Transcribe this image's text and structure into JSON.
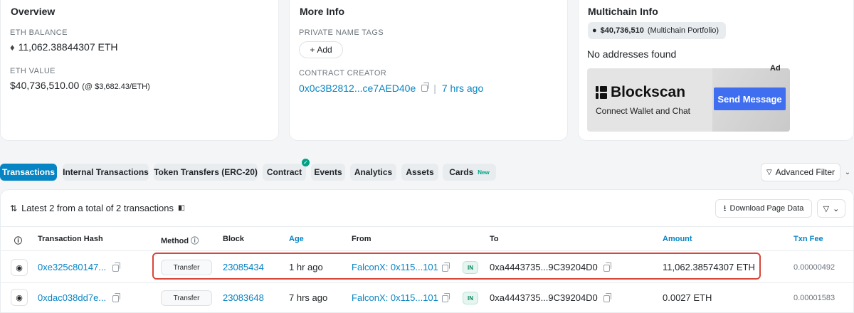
{
  "overview": {
    "title": "Overview",
    "eth_balance_label": "ETH BALANCE",
    "eth_balance": "11,062.38844307 ETH",
    "eth_value_label": "ETH VALUE",
    "eth_value": "$40,736,510.00",
    "eth_price": "(@ $3,682.43/ETH)"
  },
  "more_info": {
    "title": "More Info",
    "private_tags_label": "PRIVATE NAME TAGS",
    "add_label": "Add",
    "creator_label": "CONTRACT CREATOR",
    "creator_address": "0x0c3B2812...ce7AED40e",
    "creator_age": "7 hrs ago"
  },
  "multichain": {
    "title": "Multichain Info",
    "portfolio_value": "$40,736,510",
    "portfolio_label": "(Multichain Portfolio)",
    "no_addresses": "No addresses found",
    "ad_tag": "Ad",
    "ad_brand": "Blockscan",
    "ad_sub": "Connect Wallet and Chat",
    "ad_button": "Send Message"
  },
  "tabs": [
    {
      "label": "Transactions",
      "active": true
    },
    {
      "label": "Internal Transactions"
    },
    {
      "label": "Token Transfers (ERC-20)"
    },
    {
      "label": "Contract",
      "verified": true
    },
    {
      "label": "Events"
    },
    {
      "label": "Analytics"
    },
    {
      "label": "Assets"
    },
    {
      "label": "Cards",
      "badge": "New"
    }
  ],
  "advanced_filter": "Advanced Filter",
  "latest_text": "Latest 2 from a total of 2 transactions",
  "download_label": "Download Page Data",
  "columns": {
    "hash": "Transaction Hash",
    "method": "Method",
    "block": "Block",
    "age": "Age",
    "from": "From",
    "to": "To",
    "amount": "Amount",
    "fee": "Txn Fee"
  },
  "rows": [
    {
      "hash": "0xe325c80147...",
      "method": "Transfer",
      "block": "23085434",
      "age": "1 hr ago",
      "from": "FalconX: 0x115...101",
      "direction": "IN",
      "to": "0xa4443735...9C39204D0",
      "amount": "11,062.38574307 ETH",
      "fee": "0.00000492"
    },
    {
      "hash": "0xdac038dd7e...",
      "method": "Transfer",
      "block": "23083648",
      "age": "7 hrs ago",
      "from": "FalconX: 0x115...101",
      "direction": "IN",
      "to": "0xa4443735...9C39204D0",
      "amount": "0.0027 ETH",
      "fee": "0.00001583"
    }
  ],
  "colors": {
    "accent": "#0784c3",
    "highlight": "#d9463b",
    "in_badge": "#00845e"
  }
}
